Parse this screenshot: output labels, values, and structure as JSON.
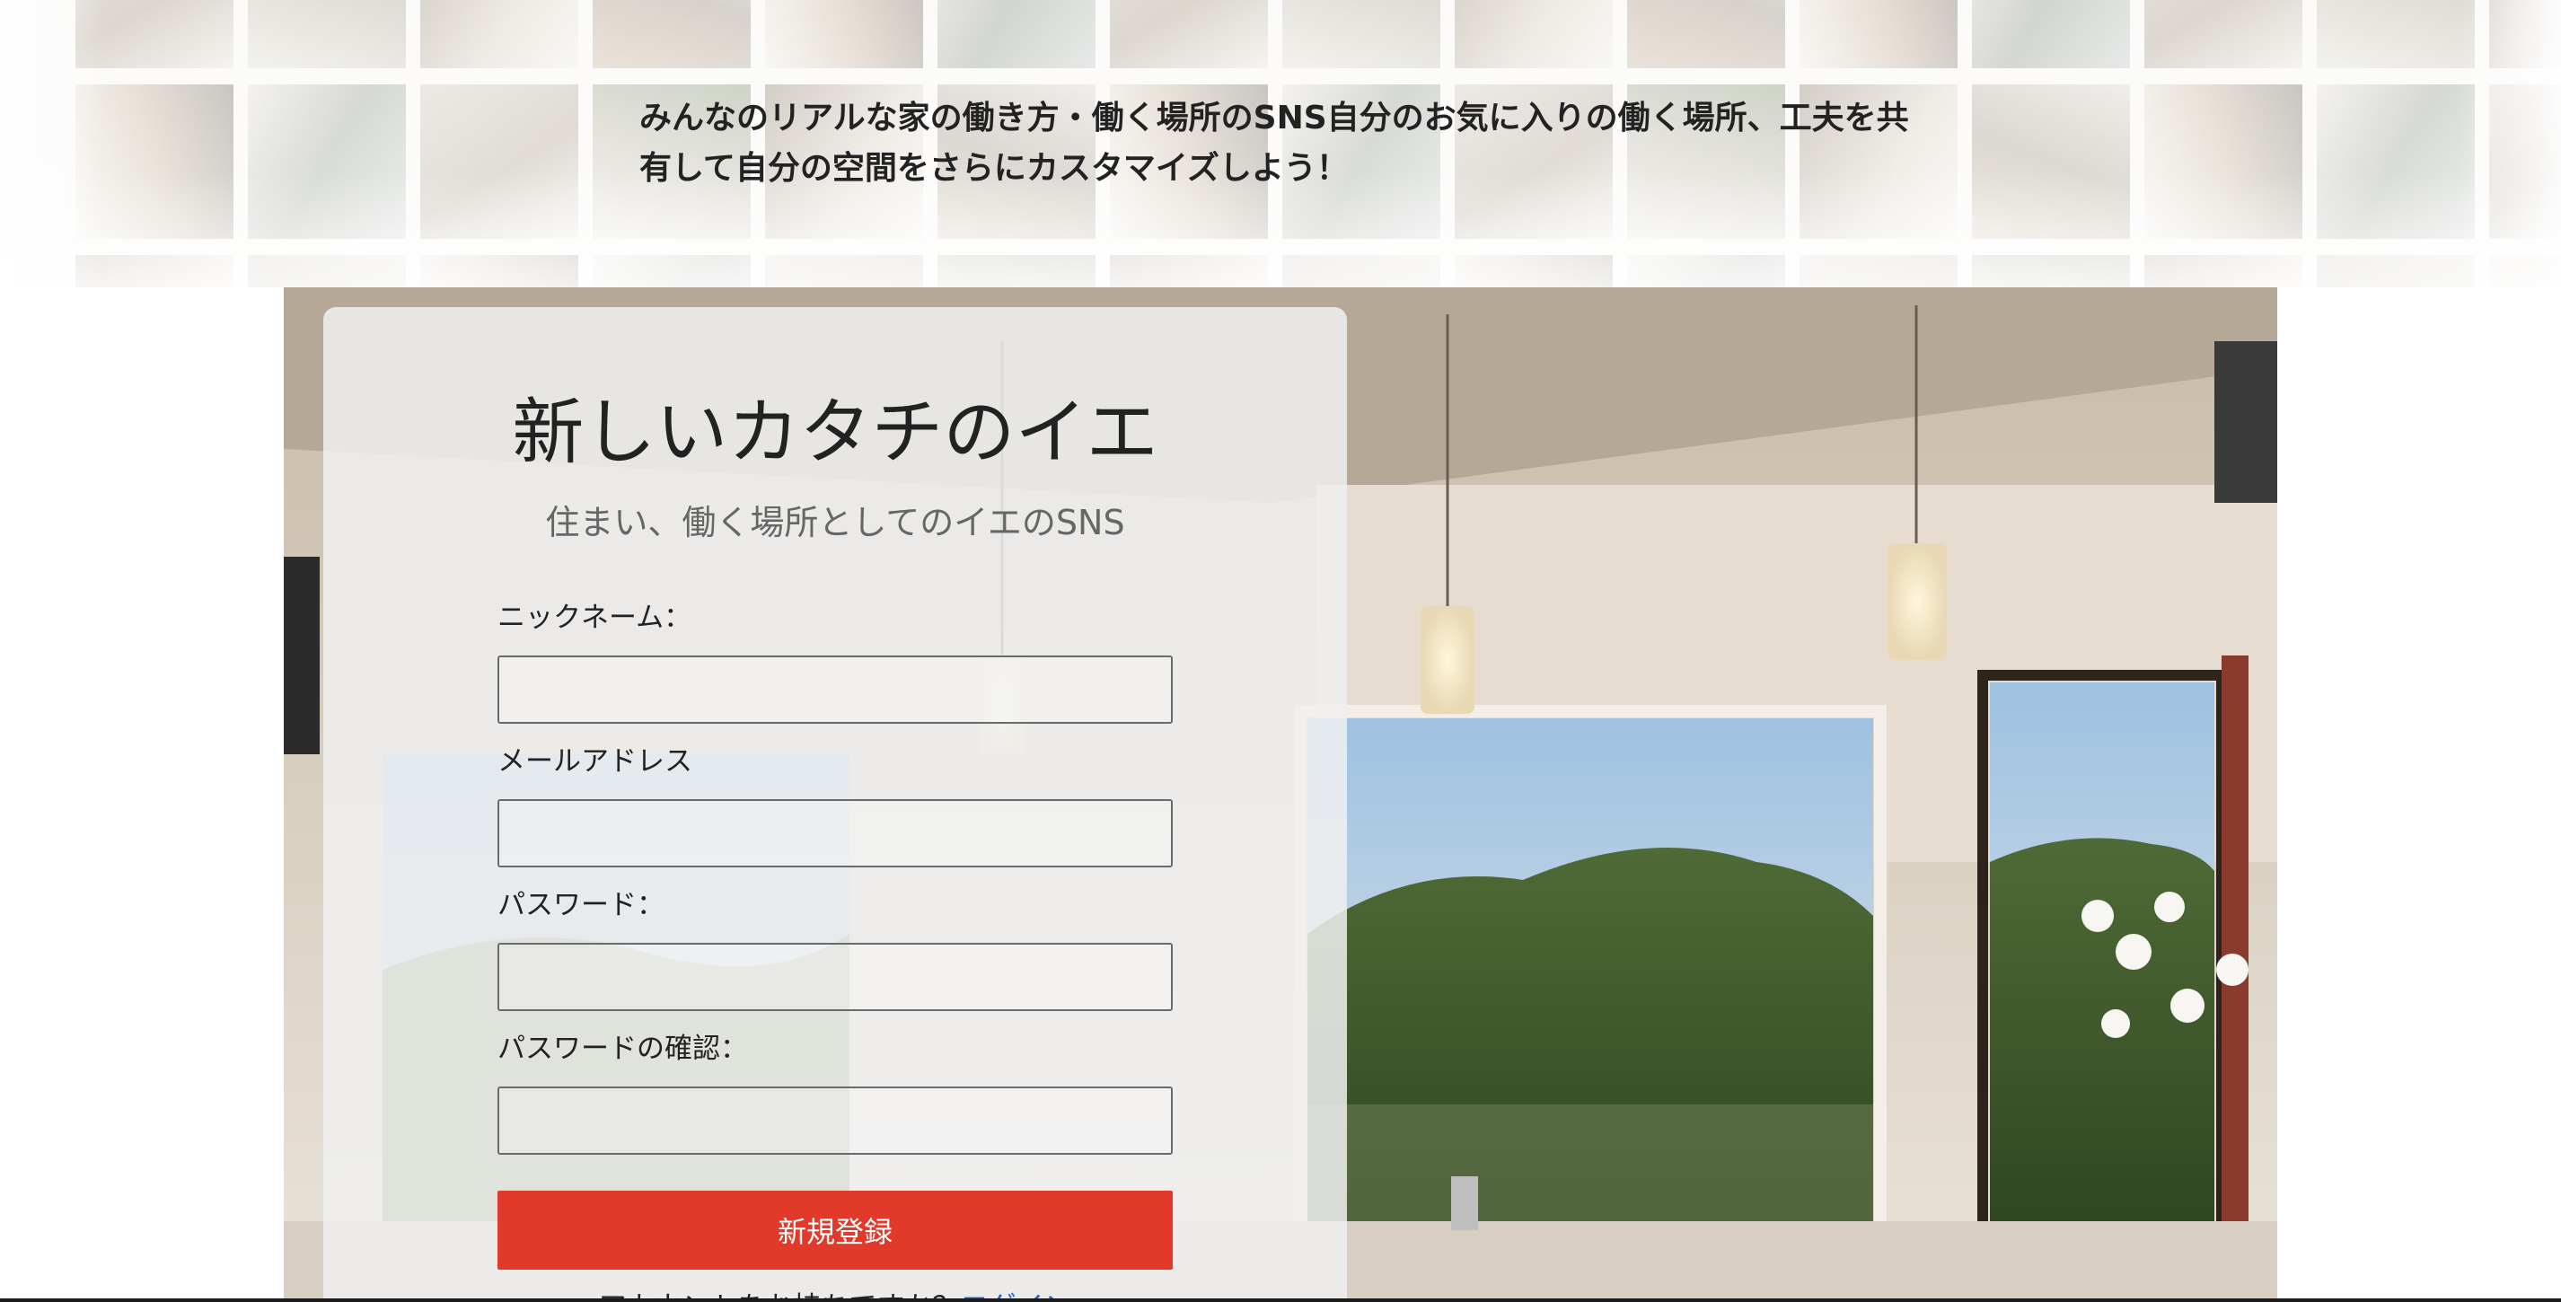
{
  "header": {
    "tagline": "みんなのリアルな家の働き方・働く場所のSNS自分のお気に入りの働く場所、工夫を共有して自分の空間をさらにカスタマイズしよう！"
  },
  "signup": {
    "title": "新しいカタチのイエ",
    "subtitle": "住まい、働く場所としてのイエのSNS",
    "fields": [
      {
        "label": "ニックネーム：",
        "value": "",
        "type": "text"
      },
      {
        "label": "メールアドレス",
        "value": "",
        "type": "email"
      },
      {
        "label": "パスワード：",
        "value": "",
        "type": "password"
      },
      {
        "label": "パスワードの確認：",
        "value": "",
        "type": "password"
      }
    ],
    "submit_label": "新規登録",
    "login_prompt": "アカウントをお持ちですか？",
    "login_link": "ログイン"
  },
  "colors": {
    "accent_button": "#e23a2a",
    "link": "#1a66d2",
    "card_background": "#f0f0f0"
  }
}
